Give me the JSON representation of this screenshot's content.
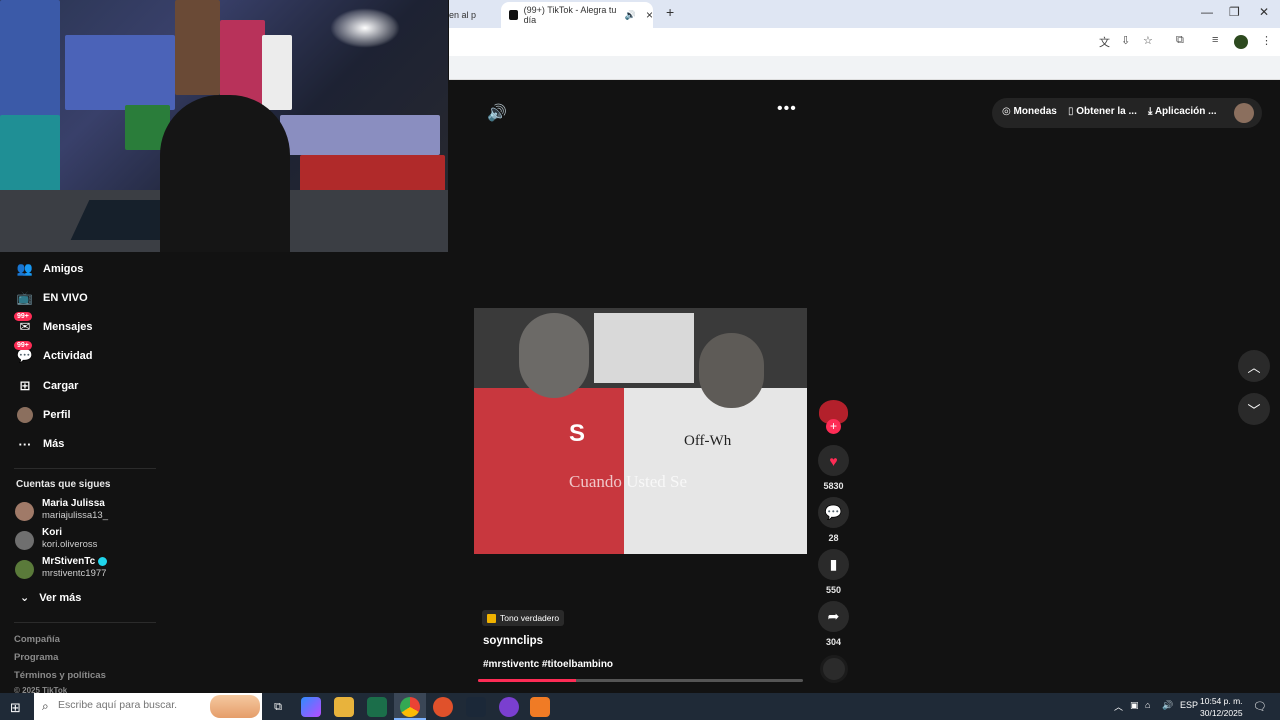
{
  "browser": {
    "prev_tab_label": "en al p",
    "active_tab_label": "(99+) TikTok - Alegra tu día",
    "new_tab": "+",
    "window_controls": {
      "minimize": "—",
      "maximize": "❐",
      "close": "✕"
    }
  },
  "tiktok": {
    "sidebar": {
      "items": [
        {
          "label": "Amigos",
          "icon": "friends-icon"
        },
        {
          "label": "EN VIVO",
          "icon": "live-icon"
        },
        {
          "label": "Mensajes",
          "icon": "messages-icon",
          "badge": "99+"
        },
        {
          "label": "Actividad",
          "icon": "activity-icon",
          "badge": "99+"
        },
        {
          "label": "Cargar",
          "icon": "upload-icon"
        },
        {
          "label": "Perfil",
          "icon": "profile-avatar"
        },
        {
          "label": "Más",
          "icon": "more-icon"
        }
      ],
      "following_title": "Cuentas que sigues",
      "following": [
        {
          "name": "Maria Julissa",
          "handle": "mariajulissa13_",
          "avatar_color": "#a07a68"
        },
        {
          "name": "Kori",
          "handle": "kori.oliveross",
          "avatar_color": "#6f6f6f"
        },
        {
          "name": "MrStivenTc",
          "handle": "mrstiventc1977",
          "avatar_color": "#5a7a3a",
          "verified": true
        }
      ],
      "see_more": "Ver más",
      "footer_links": [
        "Compañía",
        "Programa",
        "Términos y políticas",
        "© 2025 TikTok"
      ]
    },
    "top_actions": {
      "coins": "Monedas",
      "get_app": "Obtener la ...",
      "desktop_app": "Aplicación ..."
    },
    "video": {
      "subtitle": "Cuando Usted Se",
      "shirt_text": "Off-Wh",
      "shirt_letter": "S",
      "sound_tag": "Tono verdadero",
      "author": "soynnclips",
      "hashtags": "#mrstiventc #titoelbambino",
      "progress": 0.3
    },
    "actions": {
      "likes": "5830",
      "comments": "28",
      "saves": "550",
      "shares": "304"
    }
  },
  "taskbar": {
    "search_placeholder": "Escribe aquí para buscar.",
    "language": "ESP",
    "time": "10:54 p. m.",
    "date": "30/12/2025"
  },
  "colors": {
    "accent": "#fe2c55",
    "background": "#121212",
    "taskbar": "#1f2a37"
  }
}
